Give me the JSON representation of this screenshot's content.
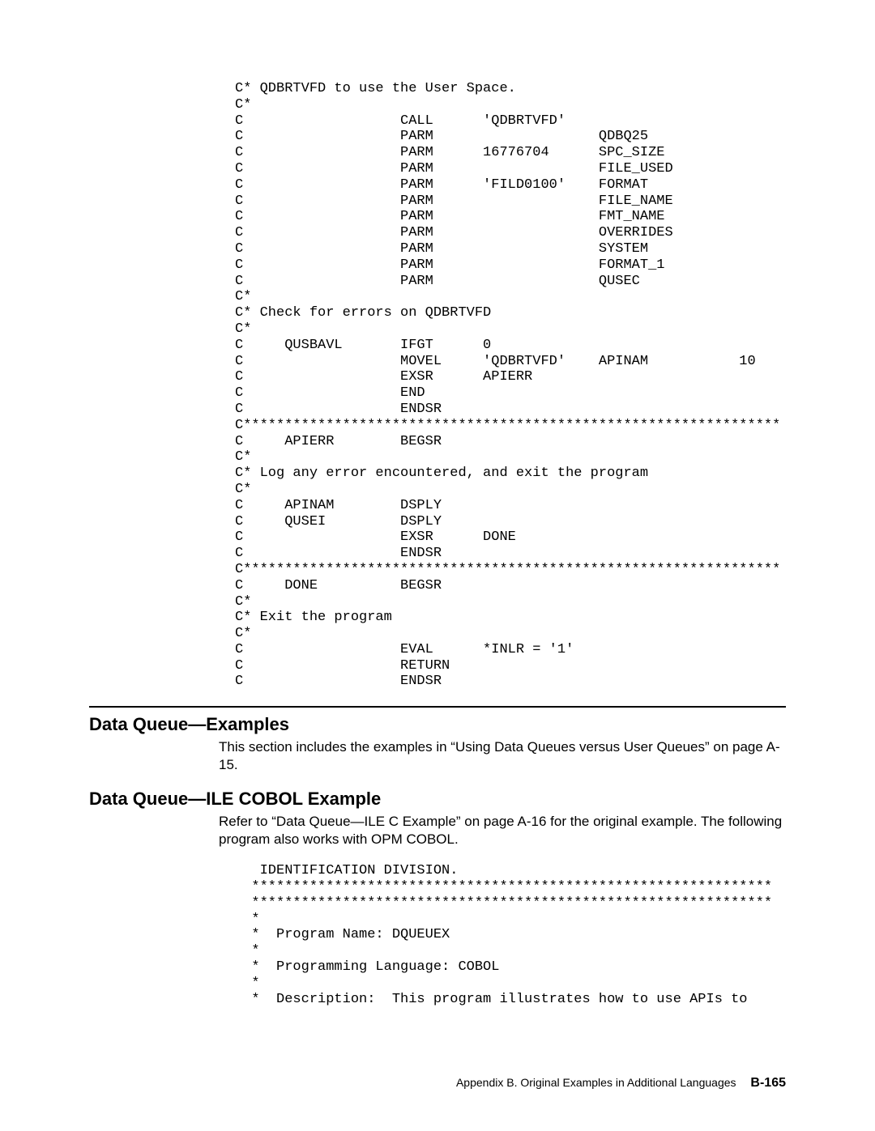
{
  "code_block_1": "C* QDBRTVFD to use the User Space.\nC*\nC                   CALL      'QDBRTVFD'\nC                   PARM                    QDBQ25\nC                   PARM      16776704      SPC_SIZE\nC                   PARM                    FILE_USED\nC                   PARM      'FILD0100'    FORMAT\nC                   PARM                    FILE_NAME\nC                   PARM                    FMT_NAME\nC                   PARM                    OVERRIDES\nC                   PARM                    SYSTEM\nC                   PARM                    FORMAT_1\nC                   PARM                    QUSEC\nC*\nC* Check for errors on QDBRTVFD\nC*\nC     QUSBAVL       IFGT      0\nC                   MOVEL     'QDBRTVFD'    APINAM           10\nC                   EXSR      APIERR\nC                   END\nC                   ENDSR\nC*****************************************************************\nC     APIERR        BEGSR\nC*\nC* Log any error encountered, and exit the program\nC*\nC     APINAM        DSPLY\nC     QUSEI         DSPLY\nC                   EXSR      DONE\nC                   ENDSR\nC*****************************************************************\nC     DONE          BEGSR\nC*\nC* Exit the program\nC*\nC                   EVAL      *INLR = '1'\nC                   RETURN\nC                   ENDSR",
  "section1": {
    "heading": "Data Queue—Examples",
    "para": "This section includes the examples in “Using Data Queues versus User Queues” on page A-15."
  },
  "section2": {
    "heading": "Data Queue—ILE COBOL Example",
    "para": "Refer to “Data Queue—ILE C Example” on page A-16 for the original example. The following program also works with OPM COBOL."
  },
  "code_block_2": "   IDENTIFICATION DIVISION.\n  ***************************************************************\n  ***************************************************************\n  *\n  *  Program Name: DQUEUEX\n  *\n  *  Programming Language: COBOL\n  *\n  *  Description:  This program illustrates how to use APIs to",
  "footer": {
    "text": "Appendix B.  Original Examples in Additional Languages",
    "page": "B-165"
  }
}
